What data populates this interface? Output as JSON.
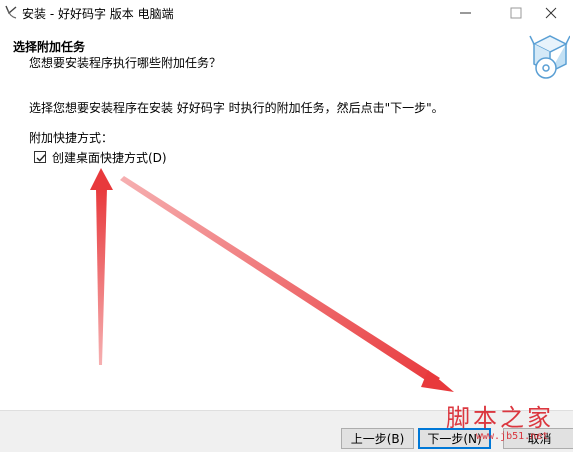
{
  "window": {
    "title": "安装 - 好好码字 版本 电脑端",
    "icon": "setup-icon"
  },
  "header": {
    "title": "选择附加任务",
    "subtitle": "您想要安装程序执行哪些附加任务？",
    "graphic": "install-box-icon"
  },
  "body": {
    "instruction": "选择您想要安装程序在安装 好好码字 时执行的附加任务，然后点击\"下一步\"。",
    "group_label": "附加快捷方式：",
    "checkbox": {
      "label": "创建桌面快捷方式(D)",
      "checked": true
    }
  },
  "footer": {
    "back_label": "上一步(B)",
    "next_label": "下一步(N)",
    "cancel_label": "取消"
  },
  "annotations": {
    "arrow_color": "#e8393c"
  },
  "watermark": {
    "text": "脚本之家",
    "url": "www.jb51.net"
  }
}
